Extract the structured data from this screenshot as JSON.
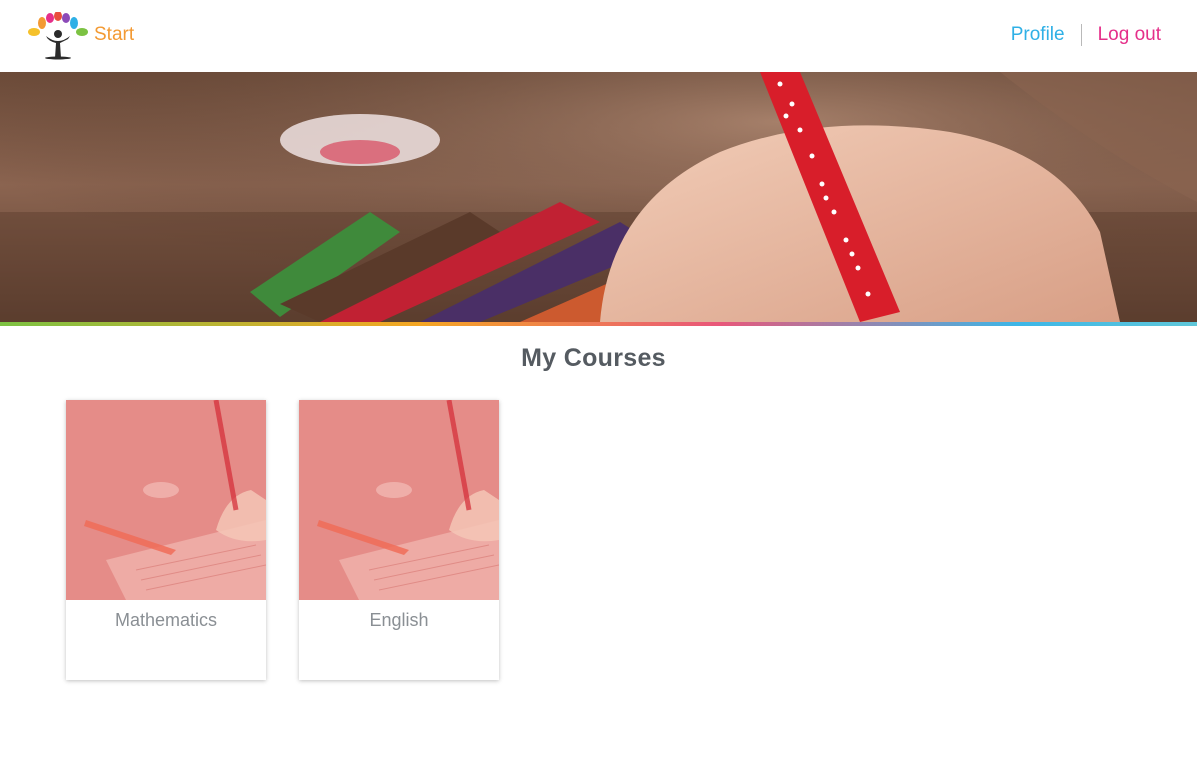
{
  "header": {
    "brand_label": "Start",
    "profile_label": "Profile",
    "logout_label": "Log out",
    "colors": {
      "brand": "#f39a33",
      "profile": "#2fb0e6",
      "logout": "#e52f8a"
    }
  },
  "hero": {
    "icon": "hero-image"
  },
  "main": {
    "title": "My Courses",
    "courses": [
      {
        "name": "Mathematics",
        "icon": "course-thumbnail"
      },
      {
        "name": "English",
        "icon": "course-thumbnail"
      }
    ]
  }
}
